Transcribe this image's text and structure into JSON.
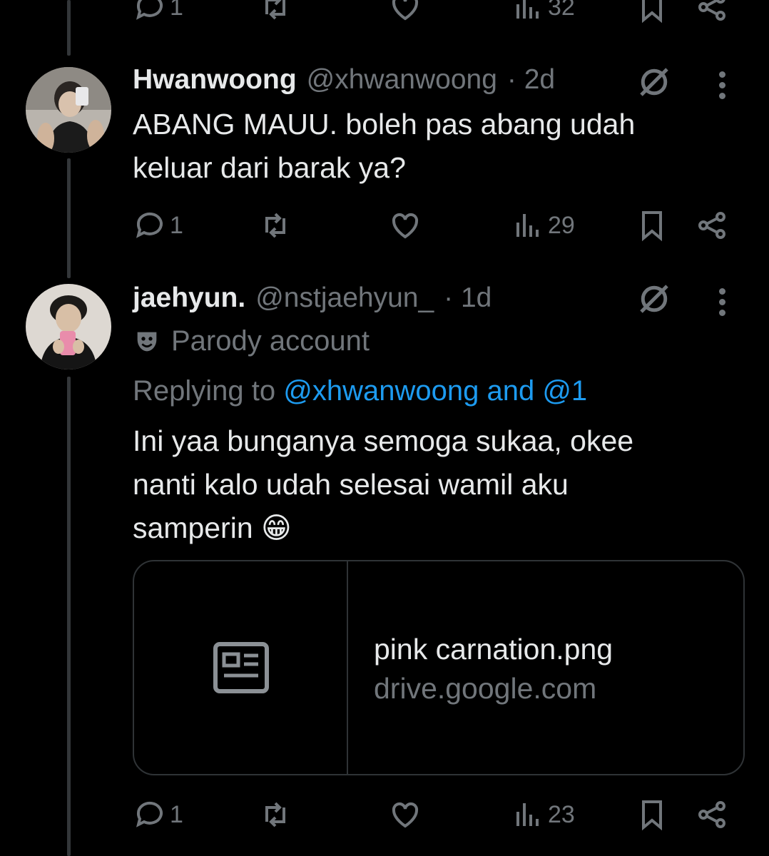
{
  "top_actions": {
    "reply_count": "1",
    "views": "32"
  },
  "tweet1": {
    "name": "Hwanwoong",
    "handle": "@xhwanwoong",
    "time": "· 2d",
    "text_line1": "ABANG MAUU. boleh pas abang udah",
    "text_line2": "keluar dari barak ya?",
    "reply_count": "1",
    "views": "29"
  },
  "tweet2": {
    "name": "jaehyun.",
    "handle": "@nstjaehyun_",
    "time": "· 1d",
    "parody_label": "Parody account",
    "replying_prefix": "Replying to",
    "replying_users": "@xhwanwoong and @1",
    "text_line1": "Ini yaa bunganya semoga sukaa, okee",
    "text_line2": "nanti kalo udah selesai wamil aku",
    "text_line3": "samperin",
    "emoji": "😁",
    "card": {
      "title": "pink carnation.png",
      "domain": "drive.google.com"
    },
    "reply_count": "1",
    "views": "23"
  },
  "colors": {
    "background": "#000000",
    "text": "#e7e9ea",
    "muted": "#71767b",
    "link": "#1d9bf0",
    "border": "#2f3336"
  }
}
